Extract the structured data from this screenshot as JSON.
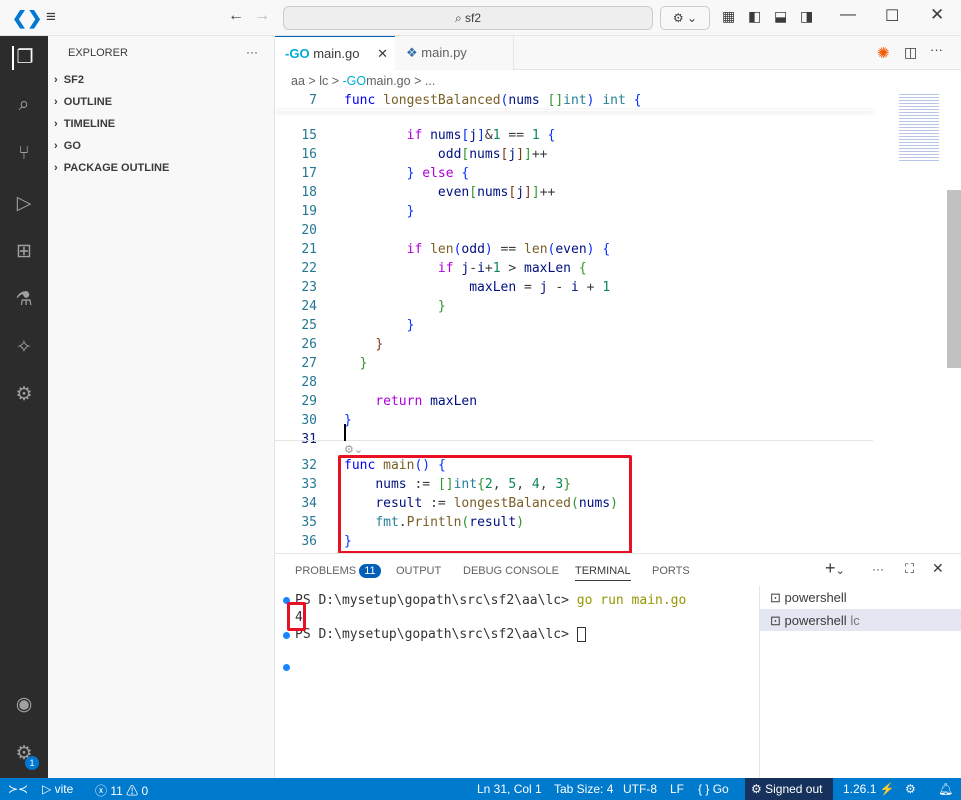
{
  "titlebar": {
    "search": "sf2"
  },
  "sidebar": {
    "title": "EXPLORER",
    "more": "···",
    "sections": [
      "SF2",
      "OUTLINE",
      "TIMELINE",
      "GO",
      "PACKAGE OUTLINE"
    ]
  },
  "tabs": [
    {
      "label": "main.go",
      "active": true
    },
    {
      "label": "main.py",
      "active": false
    }
  ],
  "breadcrumb": [
    "aa",
    ">",
    "lc",
    ">",
    "main.go",
    ">",
    "..."
  ],
  "editor": {
    "sticky": {
      "num": "7",
      "tokens": [
        [
          "func",
          "kw"
        ],
        [
          " "
        ],
        [
          "longestBalanced",
          "fn"
        ],
        [
          "(",
          "b1"
        ],
        [
          "nums ",
          "pa"
        ],
        [
          "[]",
          "b2"
        ],
        [
          "int",
          "ty"
        ],
        [
          ")",
          "b1"
        ],
        [
          " "
        ],
        [
          "int",
          "ty"
        ],
        [
          " "
        ],
        [
          "{",
          "b1"
        ]
      ]
    },
    "lines": [
      {
        "num": "15",
        "tokens": [
          [
            "        "
          ],
          [
            "if",
            "ct"
          ],
          [
            " "
          ],
          [
            "nums",
            "pa"
          ],
          [
            "[",
            "b1"
          ],
          [
            "j",
            "pa"
          ],
          [
            "]",
            "b1"
          ],
          [
            "&"
          ],
          [
            "1",
            "nu"
          ],
          [
            " == "
          ],
          [
            "1",
            "nu"
          ],
          [
            " "
          ],
          [
            "{",
            "b1"
          ]
        ]
      },
      {
        "num": "16",
        "tokens": [
          [
            "            "
          ],
          [
            "odd",
            "pa"
          ],
          [
            "[",
            "b2"
          ],
          [
            "nums",
            "pa"
          ],
          [
            "[",
            "b3"
          ],
          [
            "j",
            "pa"
          ],
          [
            "]",
            "b3"
          ],
          [
            "]",
            "b2"
          ],
          [
            "++"
          ]
        ]
      },
      {
        "num": "17",
        "tokens": [
          [
            "        "
          ],
          [
            "}",
            "b1"
          ],
          [
            " "
          ],
          [
            "else",
            "ct"
          ],
          [
            " "
          ],
          [
            "{",
            "b1"
          ]
        ]
      },
      {
        "num": "18",
        "tokens": [
          [
            "            "
          ],
          [
            "even",
            "pa"
          ],
          [
            "[",
            "b2"
          ],
          [
            "nums",
            "pa"
          ],
          [
            "[",
            "b3"
          ],
          [
            "j",
            "pa"
          ],
          [
            "]",
            "b3"
          ],
          [
            "]",
            "b2"
          ],
          [
            "++"
          ]
        ]
      },
      {
        "num": "19",
        "tokens": [
          [
            "        "
          ],
          [
            "}",
            "b1"
          ]
        ]
      },
      {
        "num": "20",
        "tokens": []
      },
      {
        "num": "21",
        "tokens": [
          [
            "        "
          ],
          [
            "if",
            "ct"
          ],
          [
            " "
          ],
          [
            "len",
            "fn"
          ],
          [
            "(",
            "b1"
          ],
          [
            "odd",
            "pa"
          ],
          [
            ")",
            "b1"
          ],
          [
            " == "
          ],
          [
            "len",
            "fn"
          ],
          [
            "(",
            "b1"
          ],
          [
            "even",
            "pa"
          ],
          [
            ")",
            "b1"
          ],
          [
            " "
          ],
          [
            "{",
            "b1"
          ]
        ]
      },
      {
        "num": "22",
        "tokens": [
          [
            "            "
          ],
          [
            "if",
            "ct"
          ],
          [
            " "
          ],
          [
            "j",
            "pa"
          ],
          [
            "-"
          ],
          [
            "i",
            "pa"
          ],
          [
            "+"
          ],
          [
            "1",
            "nu"
          ],
          [
            " > "
          ],
          [
            "maxLen",
            "pa"
          ],
          [
            " "
          ],
          [
            "{",
            "b2"
          ]
        ]
      },
      {
        "num": "23",
        "tokens": [
          [
            "                "
          ],
          [
            "maxLen",
            "pa"
          ],
          [
            " = "
          ],
          [
            "j",
            "pa"
          ],
          [
            " - "
          ],
          [
            "i",
            "pa"
          ],
          [
            " + "
          ],
          [
            "1",
            "nu"
          ]
        ]
      },
      {
        "num": "24",
        "tokens": [
          [
            "            "
          ],
          [
            "}",
            "b2"
          ]
        ]
      },
      {
        "num": "25",
        "tokens": [
          [
            "        "
          ],
          [
            "}",
            "b1"
          ]
        ]
      },
      {
        "num": "26",
        "tokens": [
          [
            "    "
          ],
          [
            "}",
            "b3"
          ]
        ]
      },
      {
        "num": "27",
        "tokens": [
          [
            "  "
          ],
          [
            "}",
            "b2"
          ]
        ]
      },
      {
        "num": "28",
        "tokens": []
      },
      {
        "num": "29",
        "tokens": [
          [
            "    "
          ],
          [
            "return",
            "ct"
          ],
          [
            " "
          ],
          [
            "maxLen",
            "pa"
          ]
        ]
      },
      {
        "num": "30",
        "tokens": [
          [
            "}",
            "b1"
          ]
        ]
      },
      {
        "num": "31",
        "tokens": []
      }
    ],
    "lines2": [
      {
        "num": "32",
        "tokens": [
          [
            "func",
            "kw"
          ],
          [
            " "
          ],
          [
            "main",
            "fn"
          ],
          [
            "()",
            "b1"
          ],
          [
            " "
          ],
          [
            "{",
            "b1"
          ]
        ]
      },
      {
        "num": "33",
        "tokens": [
          [
            "    "
          ],
          [
            "nums",
            "pa"
          ],
          [
            " := "
          ],
          [
            "[]",
            "b2"
          ],
          [
            "int",
            "ty"
          ],
          [
            "{",
            "b2"
          ],
          [
            "2",
            "nu"
          ],
          [
            ", "
          ],
          [
            "5",
            "nu"
          ],
          [
            ", "
          ],
          [
            "4",
            "nu"
          ],
          [
            ", "
          ],
          [
            "3",
            "nu"
          ],
          [
            "}",
            "b2"
          ]
        ]
      },
      {
        "num": "34",
        "tokens": [
          [
            "    "
          ],
          [
            "result",
            "pa"
          ],
          [
            " := "
          ],
          [
            "longestBalanced",
            "fn"
          ],
          [
            "(",
            "b2"
          ],
          [
            "nums",
            "pa"
          ],
          [
            ")",
            "b2"
          ]
        ]
      },
      {
        "num": "35",
        "tokens": [
          [
            "    "
          ],
          [
            "fmt",
            "ty"
          ],
          [
            "."
          ],
          [
            "Println",
            "fn"
          ],
          [
            "(",
            "b2"
          ],
          [
            "result",
            "pa"
          ],
          [
            ")",
            "b2"
          ]
        ]
      },
      {
        "num": "36",
        "tokens": [
          [
            "}",
            "b1"
          ]
        ]
      }
    ]
  },
  "panel": {
    "tabs": [
      "PROBLEMS",
      "OUTPUT",
      "DEBUG CONSOLE",
      "TERMINAL",
      "PORTS"
    ],
    "problems_count": "11",
    "terminal": {
      "line1_prompt": "PS D:\\mysetup\\gopath\\src\\sf2\\aa\\lc> ",
      "line1_cmd": "go run main.go",
      "output": "4",
      "line2_prompt": "PS D:\\mysetup\\gopath\\src\\sf2\\aa\\lc> "
    },
    "terminals": [
      {
        "label": "powershell",
        "sub": ""
      },
      {
        "label": "powershell",
        "sub": "lc"
      }
    ]
  },
  "status": {
    "remote": "vite",
    "errors": "11",
    "warnings": "0",
    "position": "Ln 31, Col 1",
    "tab_size": "Tab Size: 4",
    "encoding": "UTF-8",
    "eol": "LF",
    "language": "Go",
    "account": "Signed out",
    "version": "1.26.1"
  },
  "colors": {
    "accent": "#007acc",
    "highlight": "#e81123"
  }
}
